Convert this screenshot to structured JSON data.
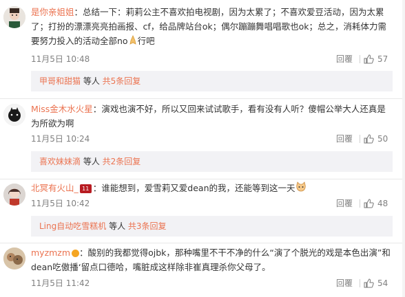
{
  "comments": [
    {
      "user": "是你亲姐姐",
      "sep": "：",
      "content_a": "总结一下：莉莉公主不喜欢拍电视剧，因为太累了；不喜欢爱豆活动，因为太累了；打扮的漂漂亮亮拍画报、cf，给品牌站台ok；偶尔蹦蹦舞唱唱歌也ok；总之，消耗体力需要努力投入的活动全部no",
      "content_b": "行吧",
      "time": "11月5日 10:48",
      "reply": "回覆",
      "likes": "57",
      "sub": {
        "who": "甲哥和甜猫",
        "mid": " 等人 ",
        "total": "共5条回复"
      }
    },
    {
      "user": "Miss金木水火星",
      "sep": "：",
      "content": "演戏也演不好，所以又回来试试歌手，看有没有人听？傻帽公举大人还真是为所欲为啊",
      "time": "11月5日 10:24",
      "reply": "回覆",
      "likes": "50",
      "sub": {
        "who": "喜欢妹妹滴",
        "mid": " 等人 ",
        "total": "共2条回复"
      }
    },
    {
      "user": "北冥有火山_",
      "sep": "：",
      "content": "谁能想到，爱雪莉又爱dean的我，还能等到这一天",
      "time": "11月5日 10:42",
      "reply": "回覆",
      "likes": "48",
      "sub": {
        "who": "Ling自动吃雪糕机",
        "mid": " 等人 ",
        "total": "共3条回复"
      }
    },
    {
      "user": "myzmzm",
      "sep": "：",
      "content": "酸别的我都觉得ojbk，那种嘴里不干不净的什么“演了个脱光的戏是本色出演”和dean吃傲播‘留点口德哈，嘴脏成这样除非崔真理杀你父母了。",
      "time": "11月5日 11:42",
      "reply": "回覆",
      "likes": "54"
    }
  ],
  "colors": {
    "username": "#eb7350",
    "meta": "#808080",
    "subbg": "#f2f2f5"
  },
  "icons": {
    "like": "thumbs-up-icon",
    "hands": "folded-hands-emoji",
    "cat": "cat-face-emoji"
  }
}
